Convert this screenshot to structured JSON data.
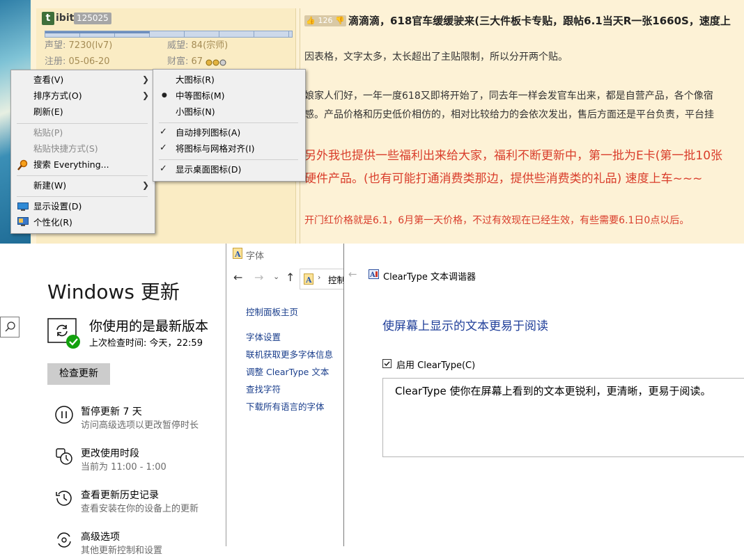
{
  "forum": {
    "avatar_letter": "t",
    "username": "ibit",
    "uid": "125025",
    "reputation_label": "声望:",
    "reputation_value": "7230(lv7)",
    "prestige_label": "威望:",
    "prestige_value": "84(宗师)",
    "register_label": "注册:",
    "register_value": "05-06-20",
    "wealth_label": "财富:",
    "wealth_value": "67",
    "like_count": "126",
    "post_title": "滴滴滴，618官车缓缓驶来(三大件板卡专贴，跟帖6.1当天R一张1660S，速度上",
    "paragraphs": [
      "因表格，文字太多，太长超出了主贴限制，所以分开两个贴。",
      "娘家人们好，一年一度618又即将开始了，同去年一样会发官车出来，都是自营产品，各个像宿",
      "感。产品价格和历史低价相仿的，相对比较给力的会依次发出，售后方面还是平台负责，平台挂"
    ],
    "red_paragraphs": [
      "另外我也提供一些福利出来给大家，福利不断更新中，第一批为E卡(第一批10张",
      "硬件产品。(也有可能打通消费类那边，提供些消费类的礼品) 速度上车~~~"
    ],
    "red_note": "开门红价格就是6.1，6月第一天价格，不过有效现在已经生效，有些需要6.1日0点以后。"
  },
  "context_menu": {
    "view": "查看(V)",
    "sort": "排序方式(O)",
    "refresh": "刷新(E)",
    "paste": "粘贴(P)",
    "paste_shortcut": "粘贴快捷方式(S)",
    "search_everything": "搜索 Everything...",
    "new": "新建(W)",
    "display_settings": "显示设置(D)",
    "personalize": "个性化(R)"
  },
  "view_submenu": {
    "large_icons": "大图标(R)",
    "medium_icons": "中等图标(M)",
    "small_icons": "小图标(N)",
    "auto_arrange": "自动排列图标(A)",
    "align_grid": "将图标与网格对齐(I)",
    "show_desktop_icons": "显示桌面图标(D)"
  },
  "windows_update": {
    "title": "Windows 更新",
    "status": "你使用的是最新版本",
    "last_check": "上次检查时间: 今天，22:59",
    "check_button": "检查更新",
    "options": [
      {
        "title": "暂停更新 7 天",
        "sub": "访问高级选项以更改暂停时长"
      },
      {
        "title": "更改使用时段",
        "sub": "当前为 11:00 - 1:00"
      },
      {
        "title": "查看更新历史记录",
        "sub": "查看安装在你的设备上的更新"
      },
      {
        "title": "高级选项",
        "sub": "其他更新控制和设置"
      }
    ]
  },
  "fonts_window": {
    "title": "字体",
    "address": "控制",
    "links": [
      "控制面板主页",
      "字体设置",
      "联机获取更多字体信息",
      "调整 ClearType 文本",
      "查找字符",
      "下载所有语言的字体"
    ]
  },
  "cleartype": {
    "title": "ClearType 文本调谐器",
    "heading": "使屏幕上显示的文本更易于阅读",
    "checkbox_label": "启用 ClearType(C)",
    "description": "ClearType 使你在屏幕上看到的文本更锐利，更清晰，更易于阅读。"
  },
  "colors": {
    "accent_blue": "#1f3e99",
    "link_blue": "#1a3e8c",
    "red_text": "#d93d2b",
    "check_green": "#13a10e"
  }
}
